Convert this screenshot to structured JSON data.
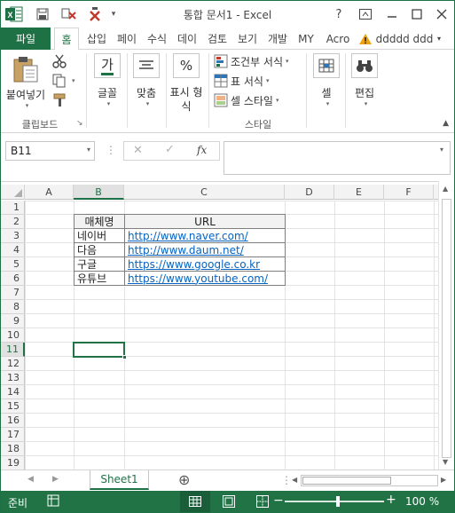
{
  "window": {
    "title": "통합 문서1 - Excel",
    "help": "?",
    "icons": [
      "excel-logo",
      "save-icon",
      "undo-icon",
      "redo-icon"
    ]
  },
  "tabs": {
    "file": "파일",
    "items": [
      "홈",
      "삽입",
      "페이",
      "수식",
      "데이",
      "검토",
      "보기",
      "개발",
      "MY",
      "Acro"
    ],
    "account": "ddddd ddd"
  },
  "ribbon": {
    "clipboard": {
      "paste": "붙여넣기",
      "label": "클립보드"
    },
    "font": {
      "label": "글꼴",
      "icon_text": "가"
    },
    "align": {
      "label": "맞춤"
    },
    "number": {
      "label": "표시 형식",
      "icon_text": "%"
    },
    "style": {
      "label": "스타일",
      "conditional": "조건부 서식",
      "table": "표 서식",
      "cell_style": "셀 스타일"
    },
    "cells": {
      "label": "셀"
    },
    "editing": {
      "label": "편집"
    }
  },
  "formula_bar": {
    "name_box": "B11",
    "fx": "fx",
    "value": ""
  },
  "grid": {
    "columns": [
      "A",
      "B",
      "C",
      "D",
      "E",
      "F"
    ],
    "selected_column": "B",
    "rows": [
      "1",
      "2",
      "3",
      "4",
      "5",
      "6",
      "7",
      "8",
      "9",
      "10",
      "11",
      "12",
      "13",
      "14",
      "15",
      "16",
      "17",
      "18",
      "19"
    ],
    "selected_row": "11",
    "table": {
      "headers": [
        "매체명",
        "URL"
      ],
      "rows": [
        [
          "네이버",
          "http://www.naver.com/"
        ],
        [
          "다음",
          "http://www.daum.net/"
        ],
        [
          "구글",
          "https://www.google.co.kr"
        ],
        [
          "유튜브",
          "https://www.youtube.com/"
        ]
      ]
    }
  },
  "sheets": {
    "active": "Sheet1",
    "add": "⊕"
  },
  "status": {
    "ready": "준비",
    "zoom": "100 %"
  },
  "colors": {
    "accent": "#217346",
    "link": "#0563c1"
  }
}
